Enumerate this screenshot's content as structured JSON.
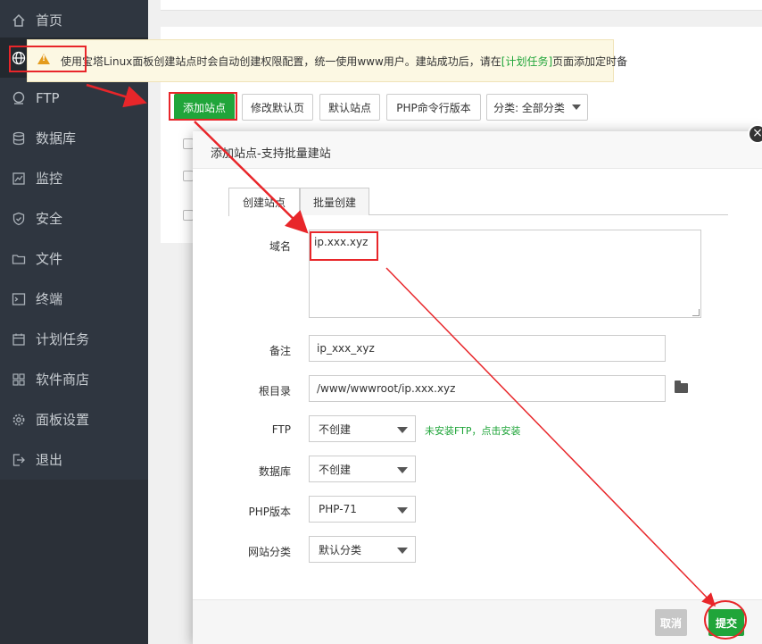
{
  "sidebar": {
    "items": [
      {
        "label": "首页",
        "icon": "home-icon"
      },
      {
        "label": "网站",
        "icon": "globe-icon"
      },
      {
        "label": "FTP",
        "icon": "ftp-icon"
      },
      {
        "label": "数据库",
        "icon": "database-icon"
      },
      {
        "label": "监控",
        "icon": "monitor-icon"
      },
      {
        "label": "安全",
        "icon": "shield-icon"
      },
      {
        "label": "文件",
        "icon": "folder-icon"
      },
      {
        "label": "终端",
        "icon": "terminal-icon"
      },
      {
        "label": "计划任务",
        "icon": "calendar-icon"
      },
      {
        "label": "软件商店",
        "icon": "grid-icon"
      },
      {
        "label": "面板设置",
        "icon": "gear-icon"
      },
      {
        "label": "退出",
        "icon": "logout-icon"
      }
    ],
    "active": "网站"
  },
  "alert": {
    "text_before": "使用宝塔Linux面板创建站点时会自动创建权限配置，统一使用www用户。建站成功后，请在",
    "link": "[计划任务]",
    "text_after": "页面添加定时备"
  },
  "toolbar": {
    "add_site": "添加站点",
    "edit_default_page": "修改默认页",
    "default_site": "默认站点",
    "php_cli_version": "PHP命令行版本",
    "category": "分类: 全部分类"
  },
  "modal": {
    "title": "添加站点-支持批量建站",
    "tabs": [
      "创建站点",
      "批量创建"
    ],
    "fields": {
      "domain": {
        "label": "域名",
        "value": "ip.xxx.xyz"
      },
      "remark": {
        "label": "备注",
        "value": "ip_xxx_xyz"
      },
      "root": {
        "label": "根目录",
        "value": "/www/wwwroot/ip.xxx.xyz"
      },
      "ftp": {
        "label": "FTP",
        "value": "不创建",
        "hint": "未安装FTP，点击安装"
      },
      "database": {
        "label": "数据库",
        "value": "不创建"
      },
      "php": {
        "label": "PHP版本",
        "value": "PHP-71"
      },
      "category": {
        "label": "网站分类",
        "value": "默认分类"
      }
    },
    "footer": {
      "cancel": "取消",
      "submit": "提交"
    },
    "close": "×"
  },
  "colors": {
    "brand_green": "#20a53a",
    "sidebar_bg": "#2f3640",
    "annotation_red": "#e8262a"
  }
}
